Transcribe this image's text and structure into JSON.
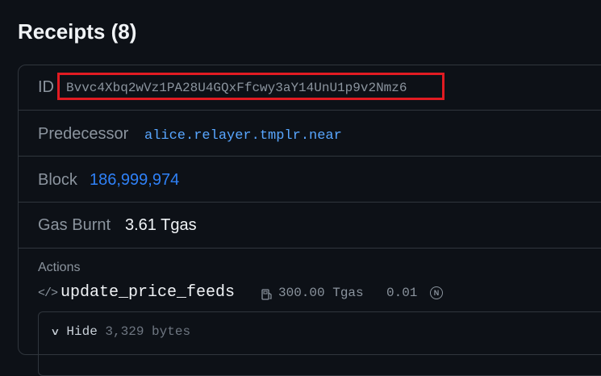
{
  "header": {
    "title": "Receipts (8)"
  },
  "receipt": {
    "id_label": "ID",
    "id_value": "Bvvc4Xbq2wVz1PA28U4GQxFfcwy3aY14UnU1p9v2Nmz6",
    "predecessor_label": "Predecessor",
    "predecessor_value": "alice.relayer.tmplr.near",
    "block_label": "Block",
    "block_value": "186,999,974",
    "gas_label": "Gas Burnt",
    "gas_value": "3.61 Tgas",
    "actions_label": "Actions",
    "action": {
      "icon": "code-icon",
      "code_glyph": "</>",
      "method": "update_price_feeds",
      "gas": "300.00 Tgas",
      "deposit": "0.01",
      "near_glyph": "N",
      "toggle_label": "Hide",
      "bytes": "3,329 bytes"
    }
  },
  "colors": {
    "background": "#0d1117",
    "border": "#30363d",
    "link": "#2f81f7",
    "highlight": "#e11b22"
  }
}
